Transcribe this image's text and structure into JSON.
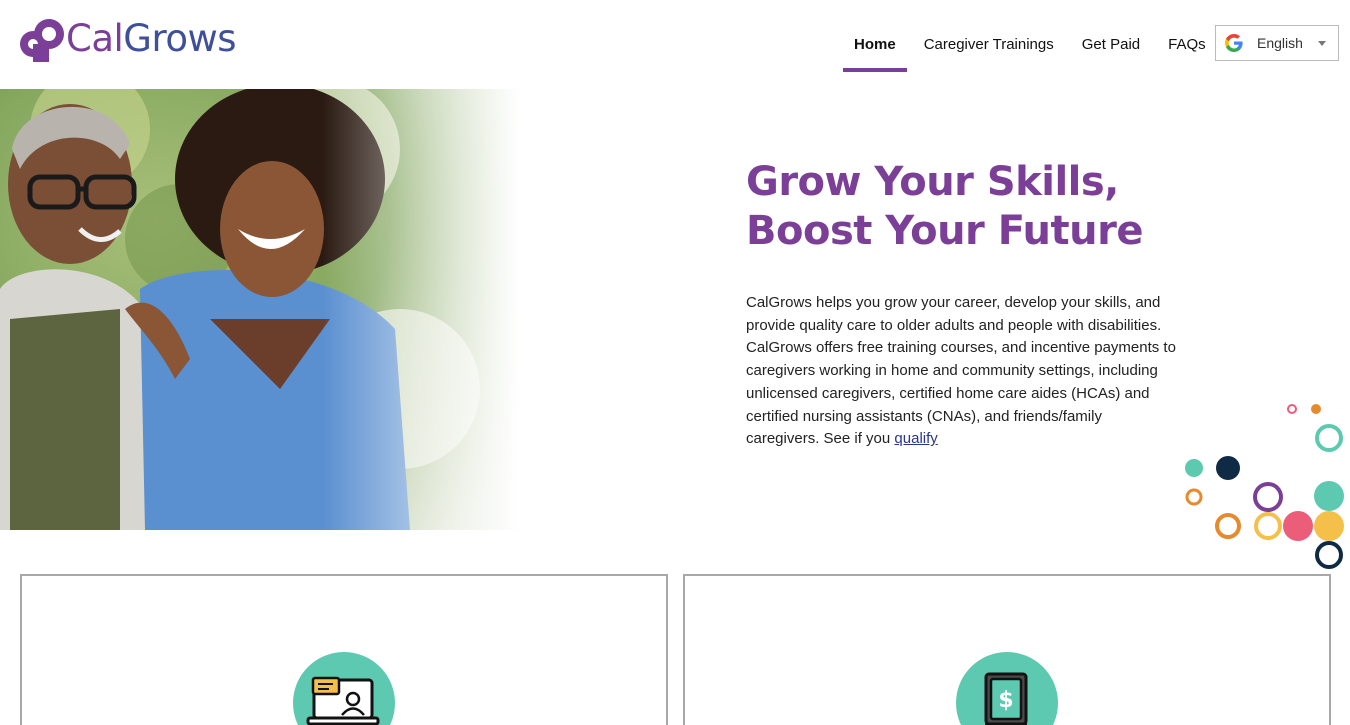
{
  "header": {
    "logo": {
      "text_part1": "Cal",
      "text_part2": "Grows",
      "icon": "calgrows-logo-icon"
    },
    "nav": [
      {
        "label": "Home",
        "active": true
      },
      {
        "label": "Caregiver Trainings",
        "active": false
      },
      {
        "label": "Get Paid",
        "active": false
      },
      {
        "label": "FAQs",
        "active": false
      }
    ],
    "language_select": {
      "icon": "google-g-icon",
      "selected": "English"
    }
  },
  "hero": {
    "image_icon": "caregiver-photo",
    "title_line1": "Grow Your Skills,",
    "title_line2": "Boost Your Future",
    "body": "CalGrows helps you grow your career, develop your skills, and provide quality care to older adults and people with disabilities. CalGrows offers free training courses, and incentive payments to caregivers working in home and community settings, including unlicensed caregivers, certified home care aides (HCAs) and certified nursing assistants (CNAs), and friends/family caregivers. See if you",
    "link": "qualify"
  },
  "cards": [
    {
      "icon": "online-training-icon"
    },
    {
      "icon": "payment-book-icon"
    }
  ],
  "colors": {
    "brand_purple": "#7b3f98",
    "brand_blue": "#3f4f9a",
    "teal": "#5dc9b0",
    "navy": "#0f2a44",
    "orange": "#e8892b",
    "yellow": "#f5c04a",
    "pink": "#ec5d7a"
  }
}
